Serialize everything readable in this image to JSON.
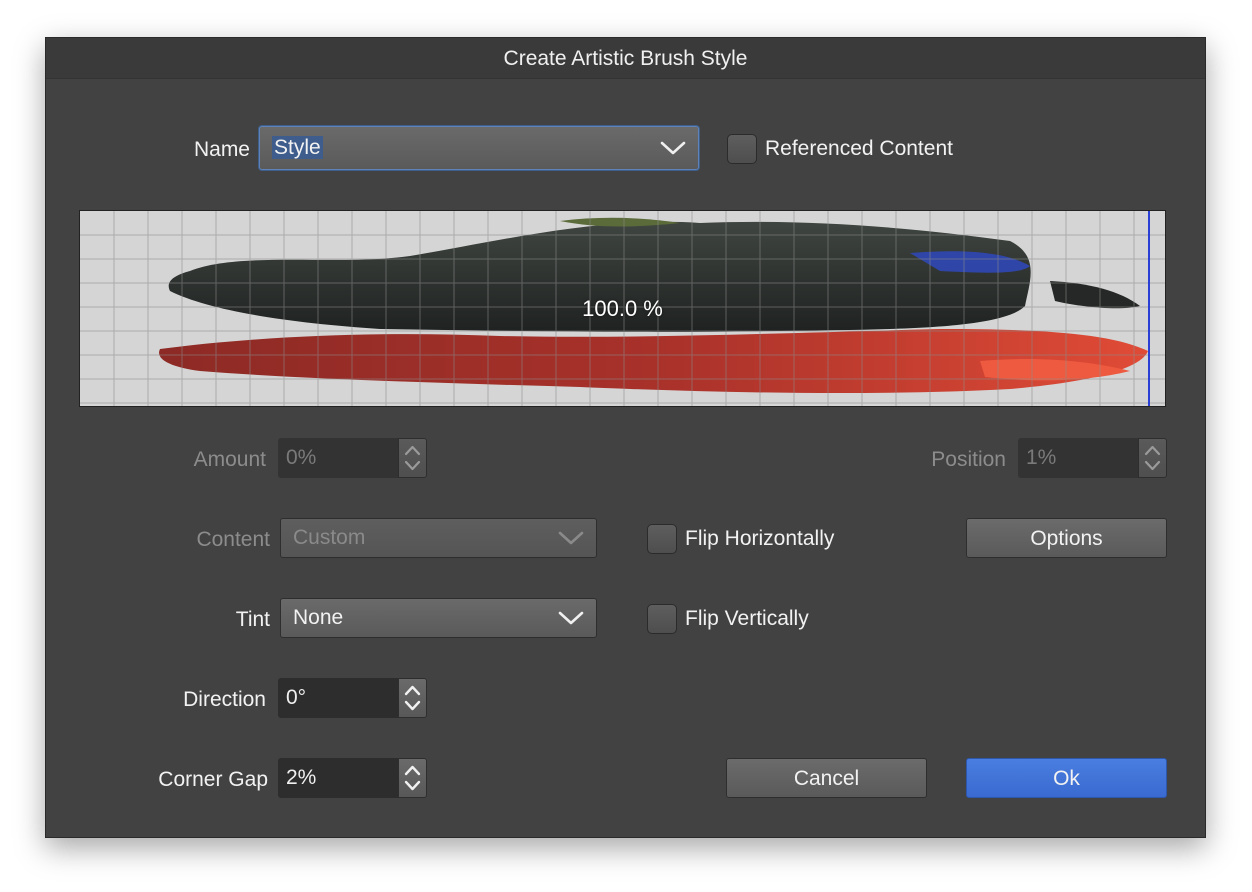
{
  "dialog": {
    "title": "Create Artistic Brush Style",
    "name_label": "Name",
    "name_value": "Style",
    "referenced_content_label": "Referenced Content",
    "preview_zoom": "100.0 %",
    "amount_label": "Amount",
    "amount_value": "0%",
    "position_label": "Position",
    "position_value": "1%",
    "content_label": "Content",
    "content_value": "Custom",
    "flip_horizontally_label": "Flip Horizontally",
    "options_label": "Options",
    "tint_label": "Tint",
    "tint_value": "None",
    "flip_vertically_label": "Flip Vertically",
    "direction_label": "Direction",
    "direction_value": "0°",
    "corner_gap_label": "Corner Gap",
    "corner_gap_value": "2%",
    "cancel_label": "Cancel",
    "ok_label": "Ok"
  },
  "colors": {
    "dialog_bg": "#424242",
    "accent": "#3a6ad0",
    "stroke_dark": "#2b2e2b",
    "stroke_red": "#c43a2e"
  },
  "icons": {
    "dropdown": "chevron-down-icon",
    "stepper": "updown-arrows-icon"
  }
}
